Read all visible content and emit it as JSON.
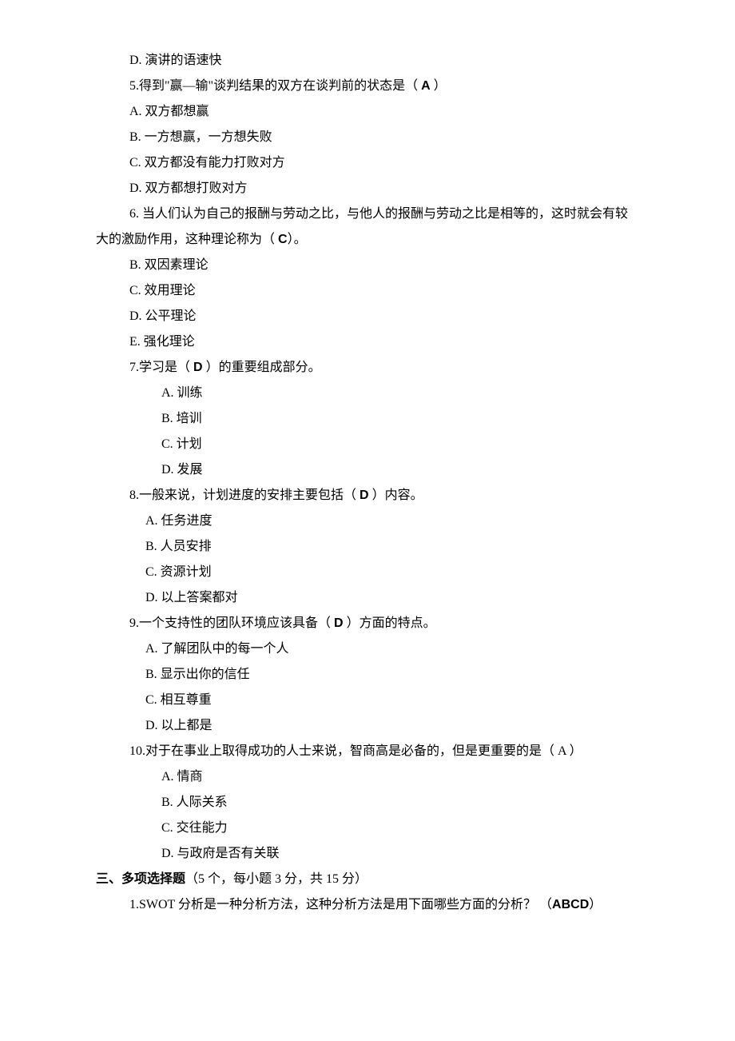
{
  "q5_opt_d": "D.  演讲的语速快",
  "q5_stem_a": "5.得到\"赢—输\"谈判结果的双方在谈判前的状态是（ ",
  "q5_stem_answer": "A",
  "q5_stem_b": " ）",
  "q5_a": "A.  双方都想赢",
  "q5_b": "B.  一方想赢，一方想失败",
  "q5_c": "C.  双方都没有能力打败对方",
  "q5_d": "D.  双方都想打败对方",
  "q6_stem_a": "6. 当人们认为自己的报酬与劳动之比，与他人的报酬与劳动之比是相等的，这时就会有较大的激励作用，这种理论称为（ ",
  "q6_stem_answer": "C",
  "q6_stem_b": "）。",
  "q6_b": "B.  双因素理论",
  "q6_c": "C.  效用理论",
  "q6_d": "D.  公平理论",
  "q6_e": "E.  强化理论",
  "q7_stem_a": "7.学习是（ ",
  "q7_stem_answer": "D",
  "q7_stem_b": " ）的重要组成部分。",
  "q7_a": "A. 训练",
  "q7_b": "B. 培训",
  "q7_c": "C. 计划",
  "q7_d": "D. 发展",
  "q8_stem_a": "8.一般来说，计划进度的安排主要包括（  ",
  "q8_stem_answer": "D",
  "q8_stem_b": "  ）内容。",
  "q8_a": "A.  任务进度",
  "q8_b": "B.  人员安排",
  "q8_c": "C.  资源计划",
  "q8_d": "D.  以上答案都对",
  "q9_stem_a": "9.一个支持性的团队环境应该具备（ ",
  "q9_stem_answer": "D",
  "q9_stem_b": " ）方面的特点。",
  "q9_a": "A.  了解团队中的每一个人",
  "q9_b": "B.  显示出你的信任",
  "q9_c": "C.  相互尊重",
  "q9_d": "D.  以上都是",
  "q10_stem": "10.对于在事业上取得成功的人士来说，智商高是必备的，但是更重要的是（ A ）",
  "q10_a": "A.  情商",
  "q10_b": "B.  人际关系",
  "q10_c": "C.  交往能力",
  "q10_d": "D.  与政府是否有关联",
  "section3_heading": "三、多项选择题",
  "section3_info": "（5 个，每小题 3 分，共 15 分）",
  "s3_q1_stem_a": "1.SWOT 分析是一种分析方法，这种分析方法是用下面哪些方面的分析？ （",
  "s3_q1_answer": "ABCD",
  "s3_q1_stem_b": "）"
}
